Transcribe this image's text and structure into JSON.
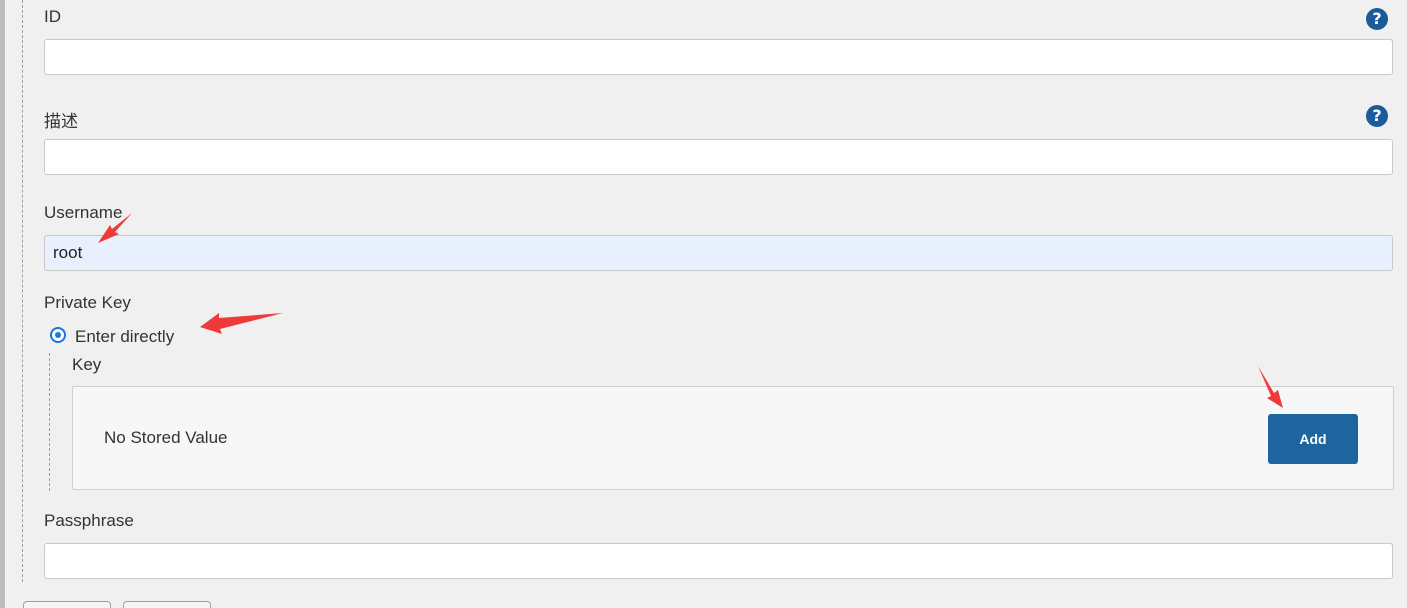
{
  "fields": {
    "id": {
      "label": "ID",
      "value": ""
    },
    "description": {
      "label": "描述",
      "value": ""
    },
    "username": {
      "label": "Username",
      "value": "root"
    },
    "private_key": {
      "label": "Private Key",
      "option_label": "Enter directly",
      "option_selected": true,
      "key_label": "Key",
      "stored_value_text": "No Stored Value",
      "add_label": "Add"
    },
    "passphrase": {
      "label": "Passphrase",
      "value": ""
    }
  },
  "icons": {
    "help": "question-mark-icon",
    "help_glyph": "?",
    "annotation": "red-arrow-icon"
  },
  "colors": {
    "accent": "#1d64a0",
    "help_icon": "#1a5b9a",
    "annotation_arrow": "#f03a3a",
    "autofill_background": "#e8f0fe"
  }
}
